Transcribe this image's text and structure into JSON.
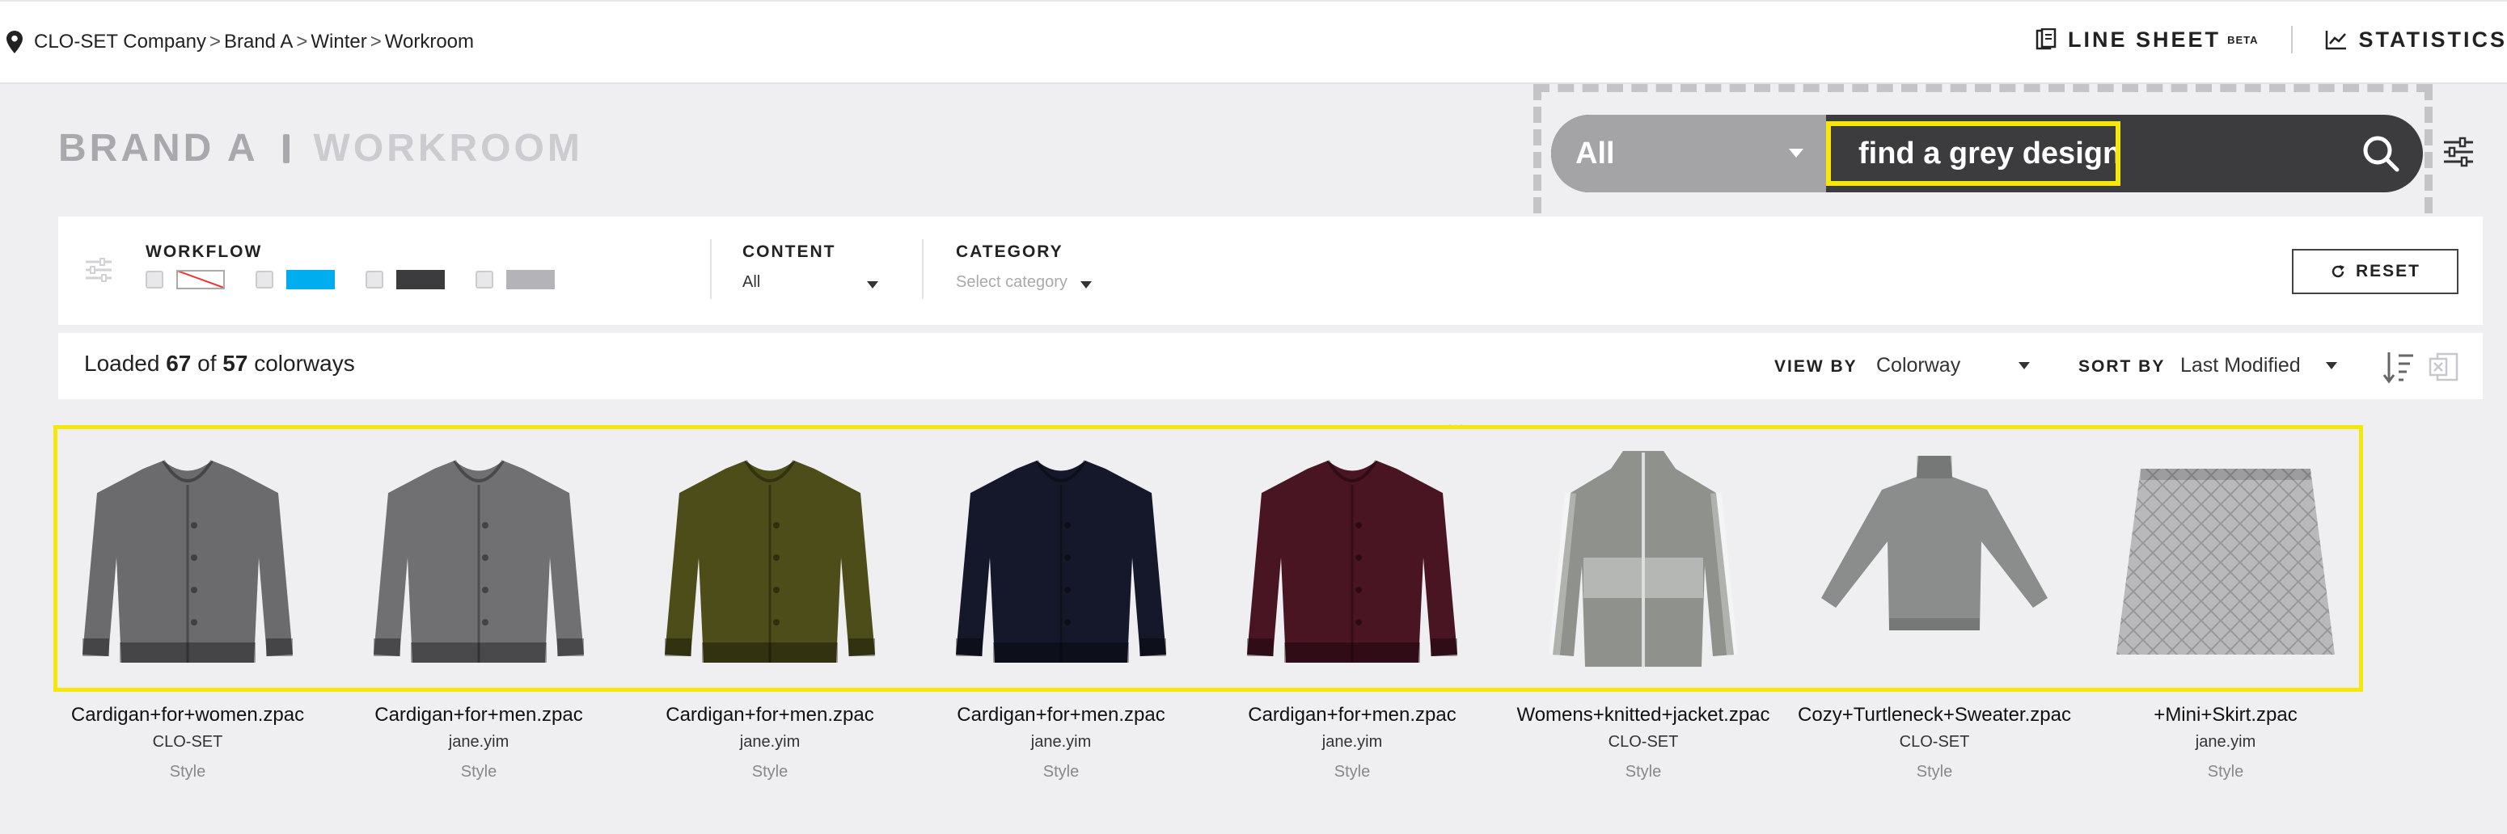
{
  "breadcrumb": {
    "items": [
      "CLO-SET Company",
      "Brand A",
      "Winter",
      "Workroom"
    ],
    "separator": ">"
  },
  "topnav": {
    "line_sheet": "LINE SHEET",
    "beta": "BETA",
    "statistics": "STATISTICS"
  },
  "page_title": {
    "brand": "BRAND A",
    "room": "WORKROOM"
  },
  "search": {
    "scope": "All",
    "query": "find a grey design"
  },
  "filters": {
    "workflow_label": "WORKFLOW",
    "content_label": "CONTENT",
    "content_value": "All",
    "category_label": "CATEGORY",
    "category_placeholder": "Select category",
    "reset_label": "RESET",
    "workflow_colors": [
      "none",
      "#00aeef",
      "#3c3c3e",
      "#b4b4b8"
    ]
  },
  "results": {
    "prefix": "Loaded",
    "loaded": "67",
    "of": "of",
    "total": "57",
    "suffix": "colorways",
    "view_by_label": "VIEW BY",
    "view_by_value": "Colorway",
    "sort_by_label": "SORT BY",
    "sort_by_value": "Last Modified"
  },
  "products": [
    {
      "name": "Cardigan+for+women.zpac",
      "owner": "CLO-SET",
      "type": "Style",
      "color": "#6b6b6e",
      "shape": "cardigan"
    },
    {
      "name": "Cardigan+for+men.zpac",
      "owner": "jane.yim",
      "type": "Style",
      "color": "#707073",
      "shape": "cardigan"
    },
    {
      "name": "Cardigan+for+men.zpac",
      "owner": "jane.yim",
      "type": "Style",
      "color": "#4d4d1a",
      "shape": "cardigan"
    },
    {
      "name": "Cardigan+for+men.zpac",
      "owner": "jane.yim",
      "type": "Style",
      "color": "#15182a",
      "shape": "cardigan"
    },
    {
      "name": "Cardigan+for+men.zpac",
      "owner": "jane.yim",
      "type": "Style",
      "color": "#4a1522",
      "shape": "cardigan"
    },
    {
      "name": "Womens+knitted+jacket.zpac",
      "owner": "CLO-SET",
      "type": "Style",
      "color": "#8e918c",
      "shape": "jacket"
    },
    {
      "name": "Cozy+Turtleneck+Sweater.zpac",
      "owner": "CLO-SET",
      "type": "Style",
      "color": "#8a8d8c",
      "shape": "turtleneck"
    },
    {
      "name": "+Mini+Skirt.zpac",
      "owner": "jane.yim",
      "type": "Style",
      "color": "#b9b9bb",
      "shape": "skirt"
    }
  ]
}
